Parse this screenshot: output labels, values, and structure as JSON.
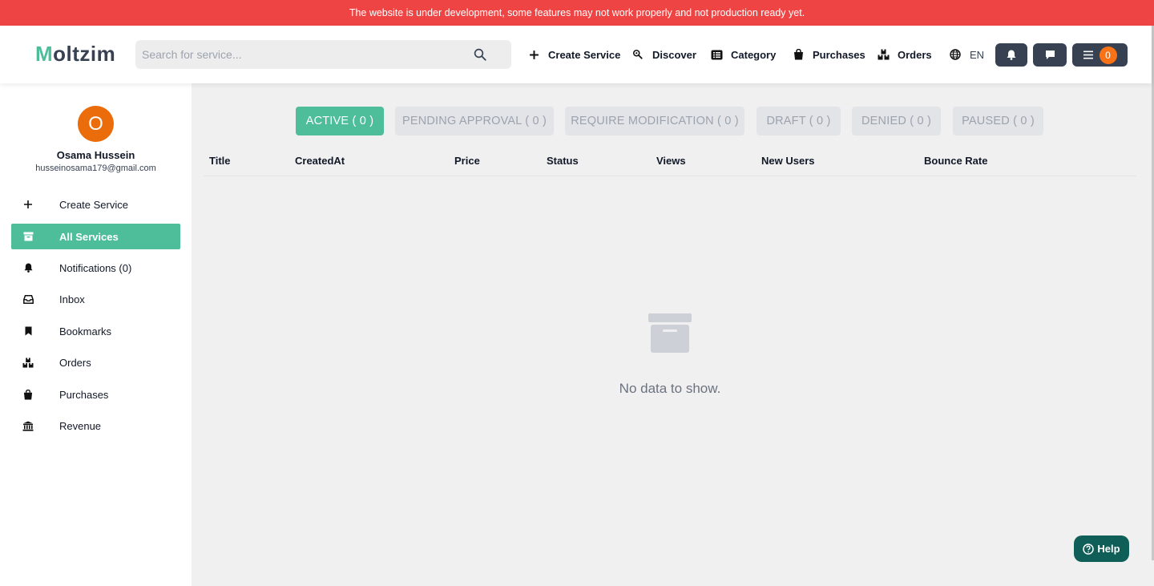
{
  "banner": {
    "text": "The website is under development, some features may not work properly and not production ready yet."
  },
  "header": {
    "logo_first": "M",
    "logo_rest": "oltzim",
    "search_placeholder": "Search for service...",
    "nav": {
      "create_service": "Create Service",
      "discover": "Discover",
      "category": "Category",
      "purchases": "Purchases",
      "orders": "Orders",
      "language": "EN"
    },
    "menu_badge": "0"
  },
  "sidebar": {
    "avatar_initial": "O",
    "user_name": "Osama Hussein",
    "user_email": "husseinosama179@gmail.com",
    "items": [
      {
        "label": "Create Service",
        "icon": "plus-icon"
      },
      {
        "label": "All Services",
        "icon": "archive-icon",
        "active": true
      },
      {
        "label": "Notifications (0)",
        "icon": "bell-icon"
      },
      {
        "label": "Inbox",
        "icon": "inbox-icon"
      },
      {
        "label": "Bookmarks",
        "icon": "bookmark-icon"
      },
      {
        "label": "Orders",
        "icon": "boxes-icon"
      },
      {
        "label": "Purchases",
        "icon": "bag-icon"
      },
      {
        "label": "Revenue",
        "icon": "bank-icon"
      }
    ]
  },
  "tabs": [
    {
      "label": "ACTIVE ( 0 )",
      "active": true
    },
    {
      "label": "PENDING APPROVAL ( 0 )"
    },
    {
      "label": "REQUIRE MODIFICATION ( 0 )"
    },
    {
      "label": "DRAFT ( 0 )"
    },
    {
      "label": "DENIED ( 0 )"
    },
    {
      "label": "PAUSED ( 0 )"
    }
  ],
  "table": {
    "columns": [
      "Title",
      "CreatedAt",
      "Price",
      "Status",
      "Views",
      "New Users",
      "Bounce Rate"
    ],
    "rows": []
  },
  "empty_state": {
    "text": "No data to show."
  },
  "help": {
    "label": "Help"
  },
  "colors": {
    "accent": "#4dbd9a",
    "banner": "#ef4444",
    "dark_button": "#374151",
    "avatar": "#ea6c0a",
    "help": "#0f5e57"
  }
}
